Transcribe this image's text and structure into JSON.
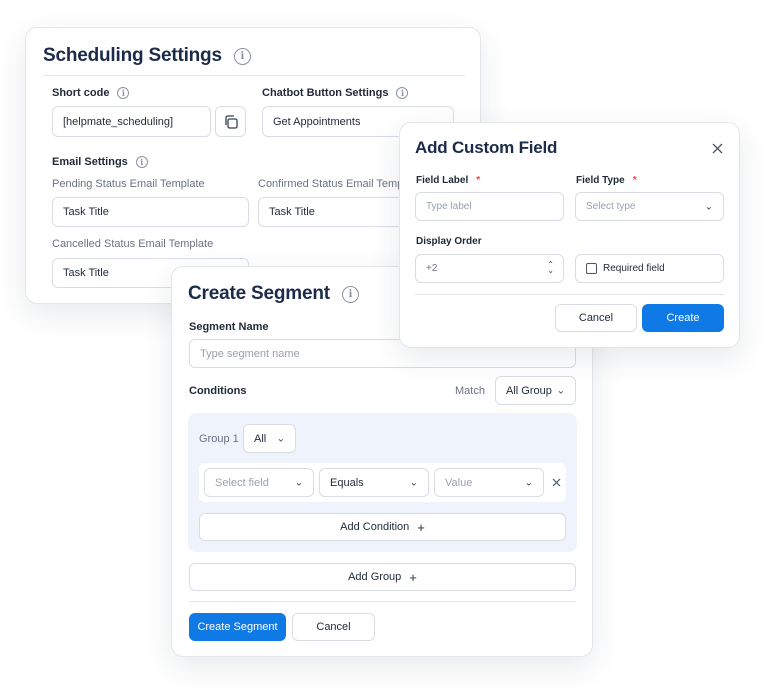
{
  "scheduling": {
    "title": "Scheduling Settings",
    "short_code_label": "Short code",
    "short_code_value": "[helpmate_scheduling]",
    "chatbot_label": "Chatbot Button Settings",
    "chatbot_value": "Get Appointments",
    "email_settings_label": "Email Settings",
    "pending_label": "Pending Status Email Template",
    "pending_value": "Task Title",
    "confirmed_label": "Confirmed Status Email Template",
    "confirmed_value": "Task Title",
    "cancelled_label": "Cancelled Status Email Template",
    "cancelled_value": "Task Title"
  },
  "segment": {
    "title": "Create Segment",
    "name_label": "Segment Name",
    "name_placeholder": "Type segment name",
    "conditions_label": "Conditions",
    "match_label": "Match",
    "match_value": "All Group",
    "group_label": "Group 1",
    "group_value": "All",
    "field_placeholder": "Select field",
    "operator_value": "Equals",
    "value_placeholder": "Value",
    "add_condition": "Add Condition",
    "add_group": "Add Group",
    "create_button": "Create Segment",
    "cancel_button": "Cancel"
  },
  "custom_field": {
    "title": "Add Custom Field",
    "field_label_label": "Field Label",
    "field_label_placeholder": "Type label",
    "field_type_label": "Field Type",
    "field_type_placeholder": "Select type",
    "display_order_label": "Display Order",
    "display_order_value": "+2",
    "required_label": "Required field",
    "cancel_button": "Cancel",
    "create_button": "Create"
  },
  "colors": {
    "primary": "#0f7ae5",
    "title": "#1c2b4a",
    "group_bg": "#eef3fc",
    "required": "#ef4444"
  },
  "icons": [
    "info-icon",
    "copy-icon",
    "close-icon",
    "chevron-down-icon",
    "stepper-icon",
    "plus-icon",
    "checkbox-icon"
  ]
}
